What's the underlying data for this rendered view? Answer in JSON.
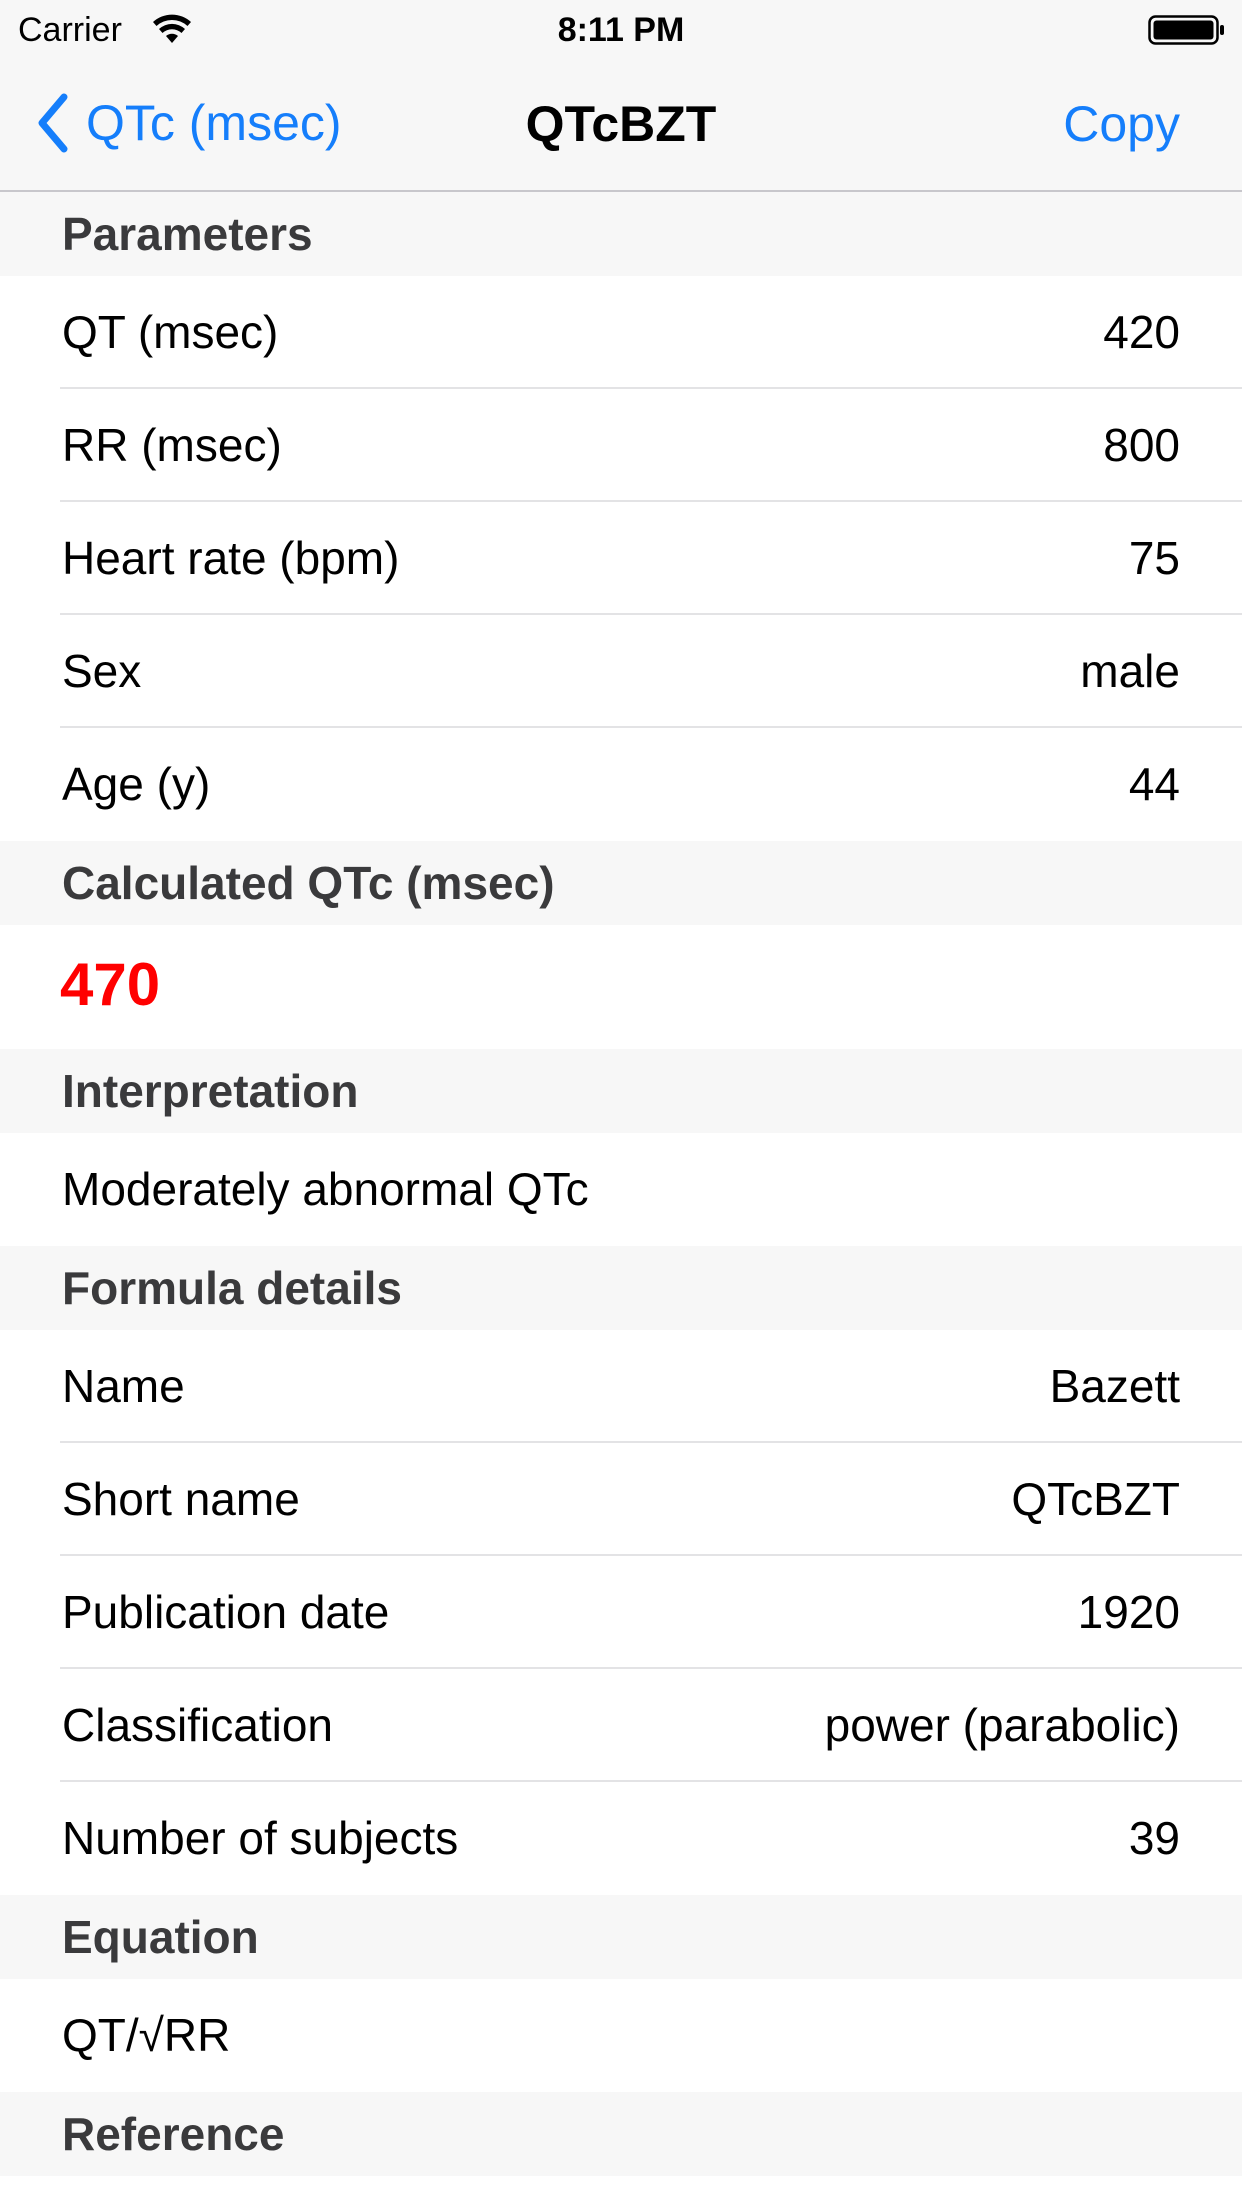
{
  "status_bar": {
    "carrier": "Carrier",
    "time": "8:11 PM",
    "icons": [
      "wifi-icon",
      "battery-icon"
    ]
  },
  "nav": {
    "back_label": "QTc (msec)",
    "title": "QTcBZT",
    "copy_label": "Copy",
    "back_icon": "chevron-left-icon",
    "accent_color": "#157efb"
  },
  "parameters": {
    "header": "Parameters",
    "rows": [
      {
        "label": "QT (msec)",
        "value": "420"
      },
      {
        "label": "RR (msec)",
        "value": "800"
      },
      {
        "label": "Heart rate (bpm)",
        "value": "75"
      },
      {
        "label": "Sex",
        "value": "male"
      },
      {
        "label": "Age (y)",
        "value": "44"
      }
    ]
  },
  "calculated": {
    "header": "Calculated QTc (msec)",
    "value": "470",
    "value_color": "#ff0000"
  },
  "interpretation": {
    "header": "Interpretation",
    "text": "Moderately abnormal QTc"
  },
  "formula_details": {
    "header": "Formula details",
    "rows": [
      {
        "label": "Name",
        "value": "Bazett"
      },
      {
        "label": "Short name",
        "value": "QTcBZT"
      },
      {
        "label": "Publication date",
        "value": "1920"
      },
      {
        "label": "Classification",
        "value": "power (parabolic)"
      },
      {
        "label": "Number of subjects",
        "value": "39"
      }
    ]
  },
  "equation": {
    "header": "Equation",
    "text": "QT/√RR"
  },
  "reference": {
    "header": "Reference"
  }
}
